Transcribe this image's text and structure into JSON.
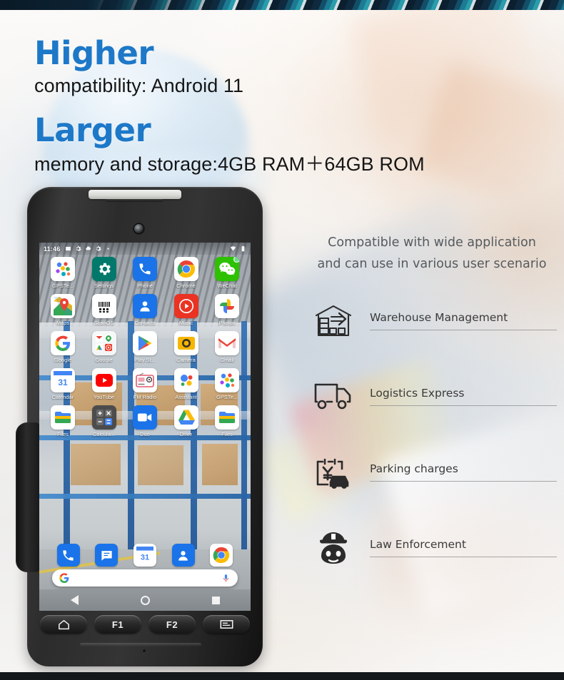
{
  "headline": {
    "keyword_1": "Higher",
    "line_1": "compatibility: Android 11",
    "keyword_2": "Larger",
    "line_2": "memory and storage:4GB RAM＋64GB ROM"
  },
  "right_panel": {
    "tagline_line_1": "Compatible with wide application",
    "tagline_line_2": "and can use in various user scenario",
    "features": [
      {
        "icon": "warehouse-icon",
        "label": "Warehouse Management"
      },
      {
        "icon": "truck-icon",
        "label": "Logistics Express"
      },
      {
        "icon": "parking-fee-icon",
        "label": "Parking charges"
      },
      {
        "icon": "police-officer-icon",
        "label": "Law Enforcement"
      }
    ]
  },
  "device": {
    "status_bar": {
      "time": "11:46",
      "icons": [
        "screenshot-icon",
        "settings-icon",
        "cloud-icon",
        "settings-icon",
        "dot-icon"
      ],
      "right_icons": [
        "wifi-icon",
        "battery-icon"
      ]
    },
    "app_rows": [
      [
        {
          "label": "GPSTe...",
          "icon": "gpstest-icon"
        },
        {
          "label": "Settings",
          "icon": "settings-gear-icon"
        },
        {
          "label": "Phone",
          "icon": "phone-icon"
        },
        {
          "label": "Chrome",
          "icon": "chrome-icon"
        },
        {
          "label": "WeChat",
          "icon": "wechat-icon",
          "badge": true
        }
      ],
      [
        {
          "label": "Maps",
          "icon": "maps-icon"
        },
        {
          "label": "ScanOS",
          "icon": "scanos-icon"
        },
        {
          "label": "Contacts",
          "icon": "contacts-icon"
        },
        {
          "label": "Music",
          "icon": "youtube-music-icon"
        },
        {
          "label": "Photos",
          "icon": "photos-icon"
        }
      ],
      [
        {
          "label": "Google",
          "icon": "google-icon"
        },
        {
          "label": "Google",
          "icon": "google-folder-icon"
        },
        {
          "label": "Play St...",
          "icon": "play-store-icon"
        },
        {
          "label": "Camera",
          "icon": "camera-icon"
        },
        {
          "label": "Gmail",
          "icon": "gmail-icon"
        }
      ],
      [
        {
          "label": "Calendar",
          "icon": "calendar-icon"
        },
        {
          "label": "YouTube",
          "icon": "youtube-icon"
        },
        {
          "label": "FM Radio",
          "icon": "fm-radio-icon"
        },
        {
          "label": "Assistant",
          "icon": "assistant-icon"
        },
        {
          "label": "GPSTe...",
          "icon": "gpstest-icon"
        }
      ],
      [
        {
          "label": "Files",
          "icon": "files-icon"
        },
        {
          "label": "Calcula...",
          "icon": "calculator-icon"
        },
        {
          "label": "Duo",
          "icon": "duo-icon"
        },
        {
          "label": "Drive",
          "icon": "drive-icon"
        },
        {
          "label": "Files",
          "icon": "files-icon"
        }
      ]
    ],
    "dock": [
      {
        "label": "Phone",
        "icon": "phone-icon"
      },
      {
        "label": "Messages",
        "icon": "messages-icon"
      },
      {
        "label": "Calendar",
        "icon": "calendar-icon"
      },
      {
        "label": "Contacts",
        "icon": "contacts-icon"
      },
      {
        "label": "Chrome",
        "icon": "chrome-icon"
      }
    ],
    "search_bar": {
      "leading_icon": "google-g-icon",
      "trailing_icon": "microphone-icon",
      "value": ""
    },
    "nav_bar": {
      "back": "back-icon",
      "home": "home-icon",
      "recents": "recents-icon"
    },
    "hardware_keys": [
      {
        "label": "",
        "icon": "home-outline-icon"
      },
      {
        "label": "F1",
        "icon": ""
      },
      {
        "label": "F2",
        "icon": ""
      },
      {
        "label": "",
        "icon": "menu-icon"
      }
    ]
  },
  "colors": {
    "heading_blue": "#1d78c8",
    "body_text": "#151515",
    "feature_text": "#3a3a3a",
    "tagline_text": "#555a5e",
    "top_band": "#0e2233"
  }
}
